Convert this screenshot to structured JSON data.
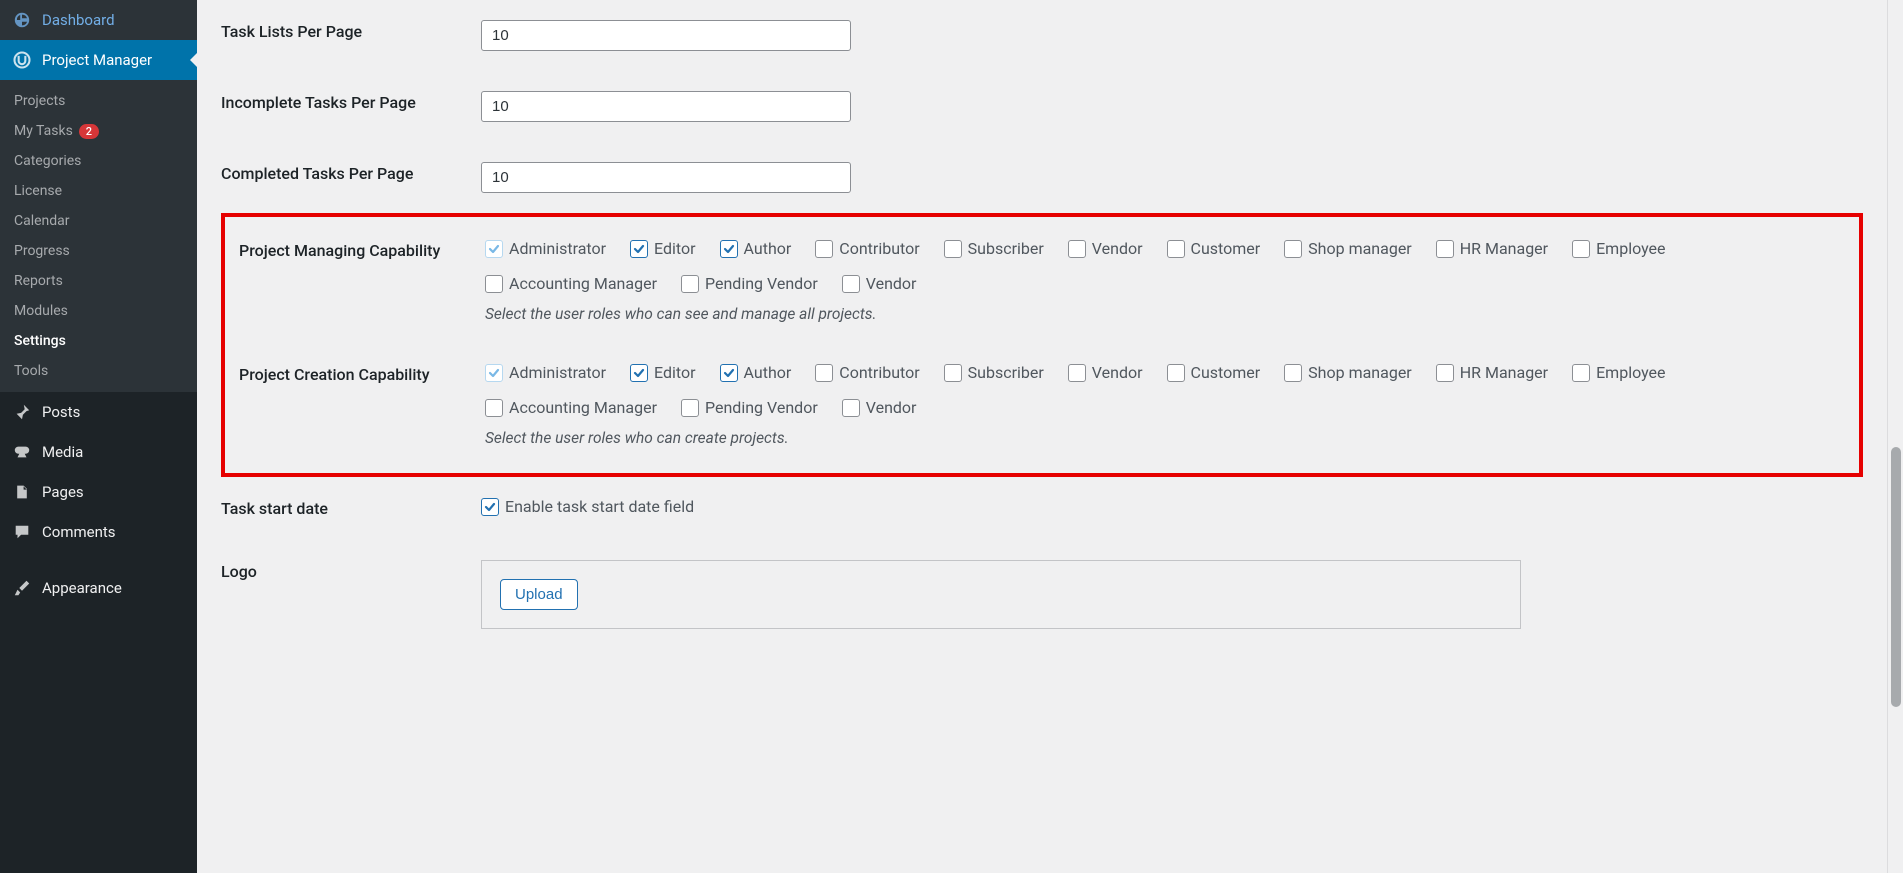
{
  "sidebar": {
    "top": [
      {
        "label": "Dashboard",
        "icon": "dashboard"
      },
      {
        "label": "Project Manager",
        "icon": "pm",
        "active": true
      }
    ],
    "submenu": [
      {
        "label": "Projects"
      },
      {
        "label": "My Tasks",
        "badge": "2"
      },
      {
        "label": "Categories"
      },
      {
        "label": "License"
      },
      {
        "label": "Calendar"
      },
      {
        "label": "Progress"
      },
      {
        "label": "Reports"
      },
      {
        "label": "Modules"
      },
      {
        "label": "Settings",
        "current": true
      },
      {
        "label": "Tools"
      }
    ],
    "bottom": [
      {
        "label": "Posts",
        "icon": "pin"
      },
      {
        "label": "Media",
        "icon": "media"
      },
      {
        "label": "Pages",
        "icon": "page"
      },
      {
        "label": "Comments",
        "icon": "comment"
      },
      {
        "label": "Appearance",
        "icon": "brush"
      }
    ]
  },
  "fields": {
    "task_lists": {
      "label": "Task Lists Per Page",
      "value": "10"
    },
    "incomplete_tasks": {
      "label": "Incomplete Tasks Per Page",
      "value": "10"
    },
    "completed_tasks": {
      "label": "Completed Tasks Per Page",
      "value": "10"
    },
    "project_manage": {
      "label": "Project Managing Capability",
      "desc": "Select the user roles who can see and manage all projects.",
      "roles": [
        {
          "label": "Administrator",
          "checked": true,
          "locked": true
        },
        {
          "label": "Editor",
          "checked": true
        },
        {
          "label": "Author",
          "checked": true
        },
        {
          "label": "Contributor",
          "checked": false
        },
        {
          "label": "Subscriber",
          "checked": false
        },
        {
          "label": "Vendor",
          "checked": false
        },
        {
          "label": "Customer",
          "checked": false
        },
        {
          "label": "Shop manager",
          "checked": false
        },
        {
          "label": "HR Manager",
          "checked": false
        },
        {
          "label": "Employee",
          "checked": false
        },
        {
          "label": "Accounting Manager",
          "checked": false
        },
        {
          "label": "Pending Vendor",
          "checked": false
        },
        {
          "label": "Vendor",
          "checked": false
        }
      ]
    },
    "project_create": {
      "label": "Project Creation Capability",
      "desc": "Select the user roles who can create projects.",
      "roles": [
        {
          "label": "Administrator",
          "checked": true,
          "locked": true
        },
        {
          "label": "Editor",
          "checked": true
        },
        {
          "label": "Author",
          "checked": true
        },
        {
          "label": "Contributor",
          "checked": false
        },
        {
          "label": "Subscriber",
          "checked": false
        },
        {
          "label": "Vendor",
          "checked": false
        },
        {
          "label": "Customer",
          "checked": false
        },
        {
          "label": "Shop manager",
          "checked": false
        },
        {
          "label": "HR Manager",
          "checked": false
        },
        {
          "label": "Employee",
          "checked": false
        },
        {
          "label": "Accounting Manager",
          "checked": false
        },
        {
          "label": "Pending Vendor",
          "checked": false
        },
        {
          "label": "Vendor",
          "checked": false
        }
      ]
    },
    "task_start": {
      "label": "Task start date",
      "option": "Enable task start date field",
      "checked": true
    },
    "logo": {
      "label": "Logo",
      "button": "Upload"
    }
  }
}
